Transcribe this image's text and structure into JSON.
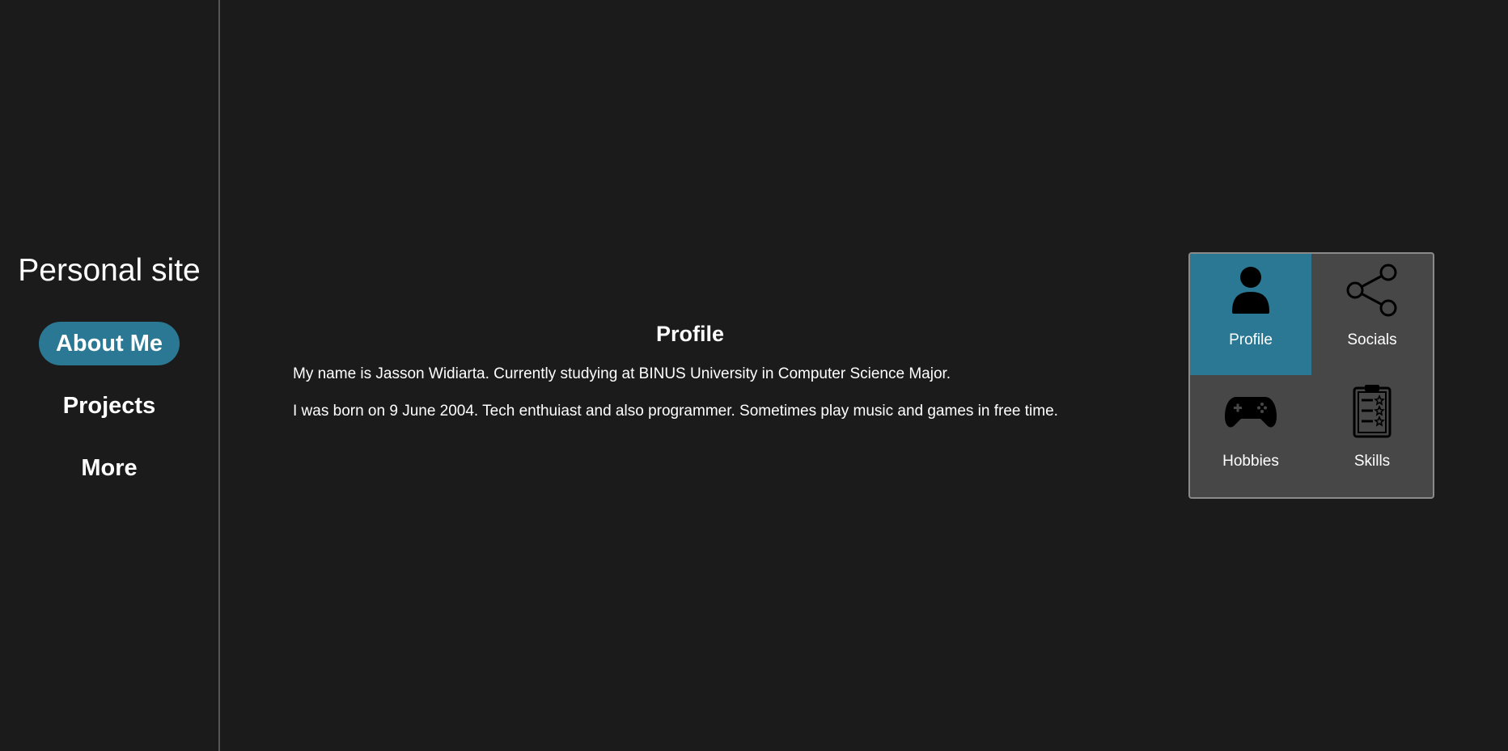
{
  "sidebar": {
    "title": "Personal site",
    "nav": [
      {
        "label": "About Me",
        "active": true
      },
      {
        "label": "Projects",
        "active": false
      },
      {
        "label": "More",
        "active": false
      }
    ]
  },
  "main": {
    "title": "Profile",
    "paragraphs": [
      "My name is Jasson Widiarta. Currently studying at BINUS University in Computer Science Major.",
      "I was born on 9 June 2004. Tech enthuiast and also programmer. Sometimes play music and games in free time."
    ]
  },
  "menu": {
    "tiles": [
      {
        "label": "Profile",
        "icon": "user-icon",
        "active": true
      },
      {
        "label": "Socials",
        "icon": "share-icon",
        "active": false
      },
      {
        "label": "Hobbies",
        "icon": "gamepad-icon",
        "active": false
      },
      {
        "label": "Skills",
        "icon": "clipboard-icon",
        "active": false
      }
    ]
  },
  "colors": {
    "background": "#1b1b1b",
    "accent": "#2a7893",
    "panel": "#474747"
  }
}
